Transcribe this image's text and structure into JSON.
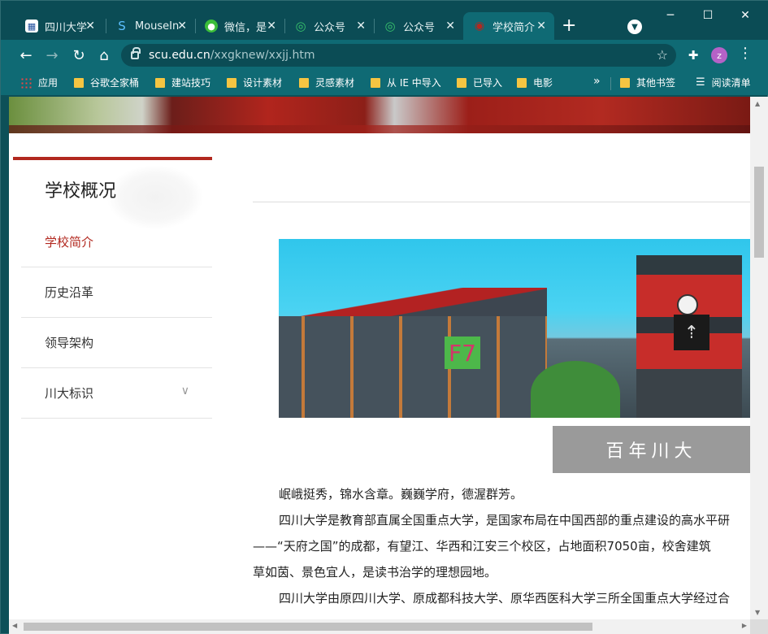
{
  "tabs": [
    {
      "title": "四川大学",
      "icon": "scu-logo-icon",
      "active": false
    },
    {
      "title": "MouseIn",
      "icon": "s-logo-icon",
      "active": false
    },
    {
      "title": "微信，是",
      "icon": "wechat-icon",
      "active": false
    },
    {
      "title": "公众号",
      "icon": "spiral-icon",
      "active": false
    },
    {
      "title": "公众号",
      "icon": "spiral-icon",
      "active": false
    },
    {
      "title": "学校简介",
      "icon": "scu-seal-icon",
      "active": true
    }
  ],
  "toolbar": {
    "url_host": "scu.edu.cn",
    "url_path": "/xxgknew/xxjj.htm",
    "profile_initial": "z"
  },
  "bookmarks": [
    {
      "label": "应用",
      "type": "apps"
    },
    {
      "label": "谷歌全家桶",
      "type": "folder"
    },
    {
      "label": "建站技巧",
      "type": "folder"
    },
    {
      "label": "设计素材",
      "type": "folder"
    },
    {
      "label": "灵感素材",
      "type": "folder"
    },
    {
      "label": "从 IE 中导入",
      "type": "folder"
    },
    {
      "label": "已导入",
      "type": "folder"
    },
    {
      "label": "电影",
      "type": "folder"
    }
  ],
  "bookmarks_right": {
    "other": "其他书签",
    "reading_list": "阅读清单"
  },
  "sidebar": {
    "title": "学校概况",
    "items": [
      {
        "label": "学校简介",
        "active": true
      },
      {
        "label": "历史沿革",
        "active": false
      },
      {
        "label": "领导架构",
        "active": false
      },
      {
        "label": "川大标识",
        "active": false
      }
    ]
  },
  "banner": {
    "overlay_label": "F7",
    "caption": "百年川大"
  },
  "article": {
    "lines": [
      "岷峨挺秀，锦水含章。巍巍学府，德渥群芳。",
      "四川大学是教育部直属全国重点大学，是国家布局在中国西部的重点建设的高水平研",
      "——“天府之国”的成都，有望江、华西和江安三个校区，占地面积7050亩，校舍建筑",
      "草如茵、景色宜人，是读书治学的理想园地。",
      "四川大学由原四川大学、原成都科技大学、原华西医科大学三所全国重点大学经过合"
    ]
  },
  "colors": {
    "accent": "#b2281f",
    "chrome": "#0f6a74"
  }
}
